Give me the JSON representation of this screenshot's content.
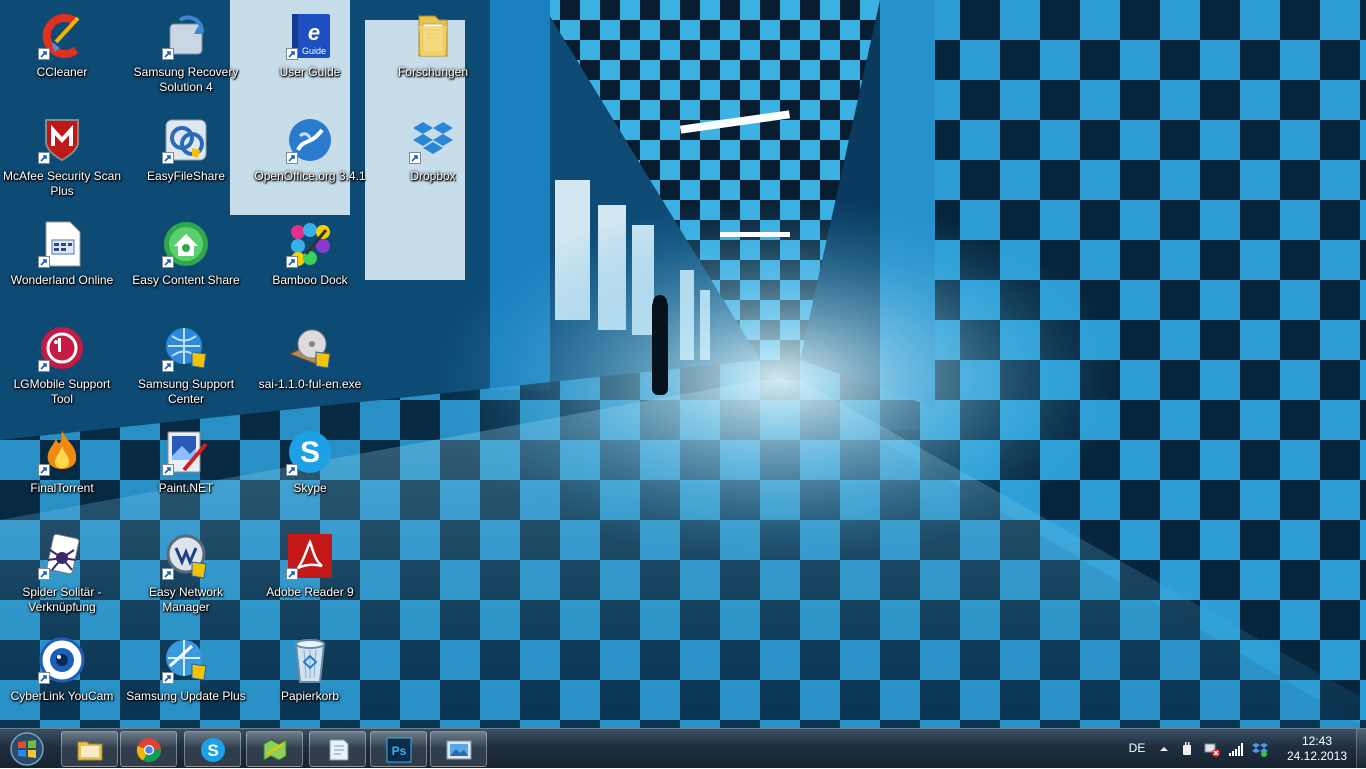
{
  "desktop": {
    "icons": [
      {
        "label": "CCleaner",
        "icon": "ccleaner-icon"
      },
      {
        "label": "McAfee Security Scan Plus",
        "icon": "mcafee-icon"
      },
      {
        "label": "Wonderland Online",
        "icon": "document-icon"
      },
      {
        "label": "LGMobile Support Tool",
        "icon": "lg-icon"
      },
      {
        "label": "FinalTorrent",
        "icon": "flame-icon"
      },
      {
        "label": "Spider Solitär - Verknüpfung",
        "icon": "spider-solitaire-icon"
      },
      {
        "label": "CyberLink YouCam",
        "icon": "webcam-icon"
      },
      {
        "label": "Samsung Recovery Solution 4",
        "icon": "recovery-icon"
      },
      {
        "label": "EasyFileShare",
        "icon": "file-share-icon"
      },
      {
        "label": "Easy Content Share",
        "icon": "content-share-icon"
      },
      {
        "label": "Samsung Support Center",
        "icon": "support-globe-icon"
      },
      {
        "label": "Paint.NET",
        "icon": "paint-icon"
      },
      {
        "label": "Easy Network Manager",
        "icon": "network-manager-icon"
      },
      {
        "label": "Samsung Update Plus",
        "icon": "update-globe-icon"
      },
      {
        "label": "User Guide",
        "icon": "user-guide-icon"
      },
      {
        "label": "OpenOffice.org 3.4.1",
        "icon": "openoffice-icon"
      },
      {
        "label": "Bamboo Dock",
        "icon": "bamboo-dock-icon"
      },
      {
        "label": "sai-1.1.0-ful-en.exe",
        "icon": "installer-disc-icon"
      },
      {
        "label": "Skype",
        "icon": "skype-icon"
      },
      {
        "label": "Adobe Reader 9",
        "icon": "adobe-reader-icon"
      },
      {
        "label": "Papierkorb",
        "icon": "recycle-bin-icon"
      },
      {
        "label": "Forschungen",
        "icon": "folder-icon"
      },
      {
        "label": "Dropbox",
        "icon": "dropbox-icon"
      }
    ]
  },
  "taskbar": {
    "start_icon": "windows-orb-icon",
    "pinned": [
      {
        "name": "taskbar-explorer-button",
        "icon": "folder-library-icon"
      },
      {
        "name": "taskbar-chrome-button",
        "icon": "chrome-icon"
      },
      {
        "name": "taskbar-skype-button",
        "icon": "skype-icon"
      },
      {
        "name": "taskbar-map-button",
        "icon": "map-app-icon"
      },
      {
        "name": "taskbar-notes-button",
        "icon": "notes-icon"
      },
      {
        "name": "taskbar-photoshop-button",
        "icon": "photoshop-icon"
      },
      {
        "name": "taskbar-photo-viewer-button",
        "icon": "photo-viewer-icon"
      }
    ],
    "photoshop_label": "Ps",
    "tray": {
      "language": "DE",
      "time": "12:43",
      "date": "24.12.2013"
    }
  },
  "colors": {
    "wallpaper_dark": "#0a3a5e",
    "wallpaper_tile": "#2aa0d8",
    "taskbar": "#1f2f40"
  }
}
